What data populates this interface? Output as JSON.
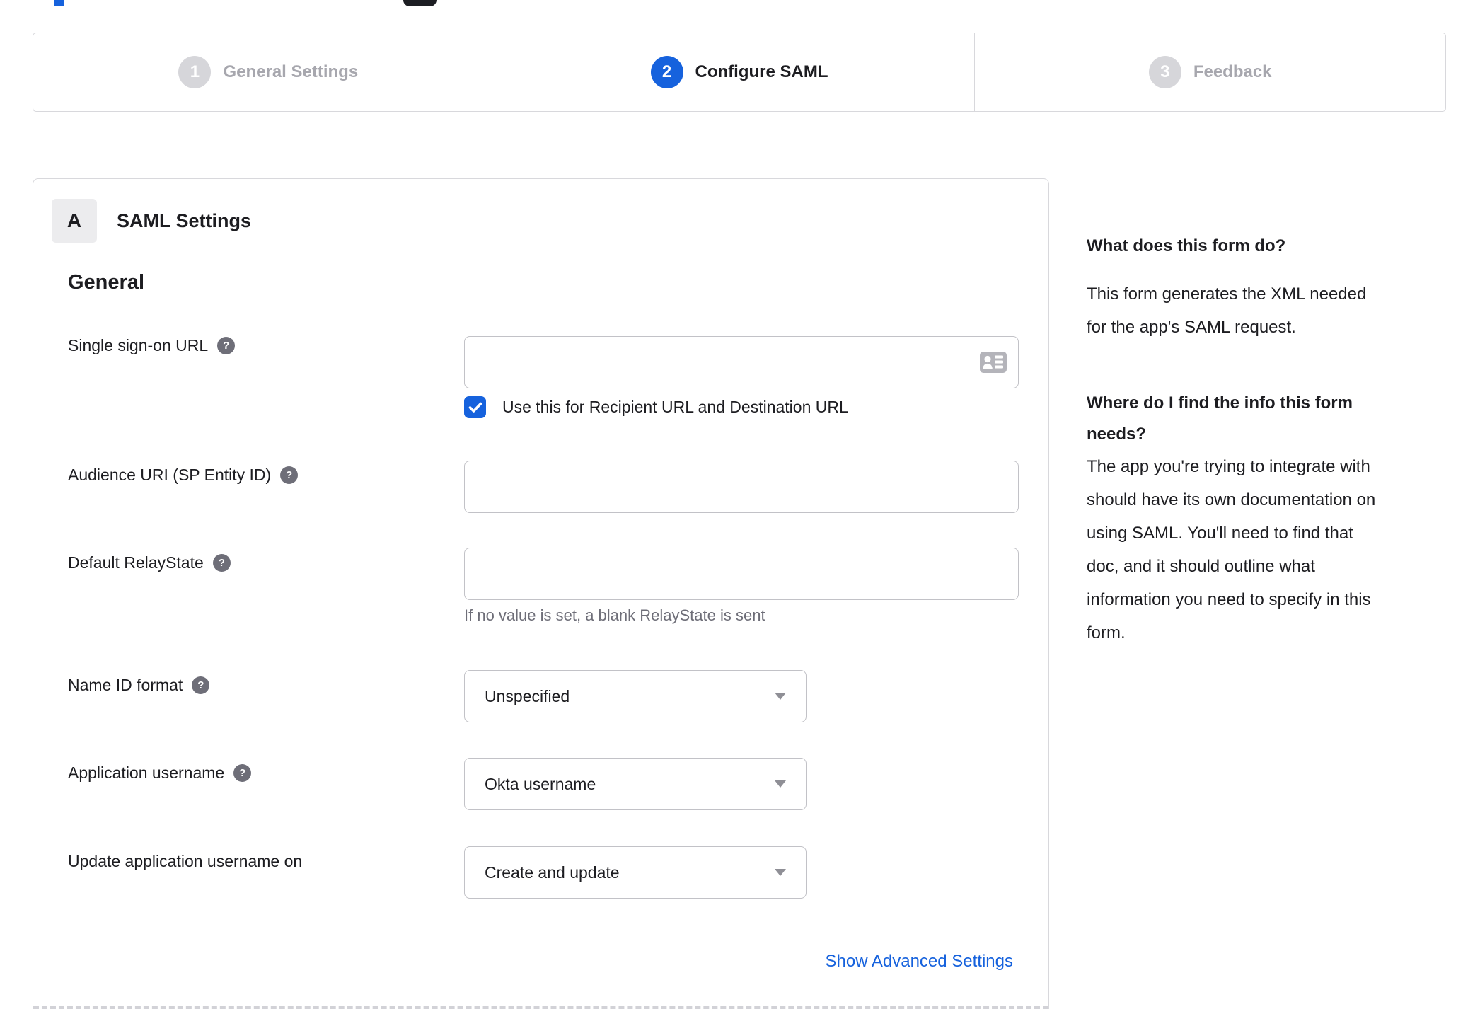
{
  "stepper": {
    "steps": [
      {
        "number": "1",
        "label": "General Settings",
        "state": "inactive"
      },
      {
        "number": "2",
        "label": "Configure SAML",
        "state": "active"
      },
      {
        "number": "3",
        "label": "Feedback",
        "state": "inactive"
      }
    ]
  },
  "panel": {
    "badge": "A",
    "title": "SAML Settings",
    "group": "General"
  },
  "form": {
    "sso": {
      "label": "Single sign-on URL",
      "value": "",
      "checkbox_label": "Use this for Recipient URL and Destination URL",
      "checkbox_checked": true
    },
    "audience": {
      "label": "Audience URI (SP Entity ID)",
      "value": ""
    },
    "relay": {
      "label": "Default RelayState",
      "value": "",
      "helper": "If no value is set, a blank RelayState is sent"
    },
    "name_id": {
      "label": "Name ID format",
      "value": "Unspecified"
    },
    "app_username": {
      "label": "Application username",
      "value": "Okta username"
    },
    "update_username": {
      "label": "Update application username on",
      "value": "Create and update"
    },
    "advanced_link": "Show Advanced Settings"
  },
  "help": {
    "q1": "What does this form do?",
    "a1_lines": [
      "This form generates the XML needed",
      "for the app's SAML request."
    ],
    "q2_lines": [
      "Where do I find the info this form",
      "needs?"
    ],
    "a2_lines": [
      "The app you're trying to integrate with",
      "should have its own documentation on",
      "using SAML. You'll need to find that",
      "doc, and it should outline what",
      "information you need to specify in this",
      "form."
    ]
  },
  "icons": {
    "help_glyph": "?"
  },
  "colors": {
    "accent": "#1662dd",
    "inactive_step": "#d6d6da",
    "text": "#1d1d21",
    "muted_text": "#6e6e78",
    "border": "#d8d8dc"
  }
}
